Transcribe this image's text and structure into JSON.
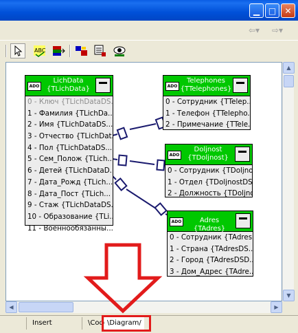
{
  "toolbar_icons": [
    "pointer-icon",
    "spell-check-icon",
    "table-color-icon",
    "link-tool-icon",
    "layout-icon",
    "view-icon"
  ],
  "diagram_tables": [
    {
      "title": "LichData",
      "subtitle": "{TLichData}",
      "icon_label": "ADO",
      "fields": [
        "0 - Ключ {TLichDataDS...",
        "1 - Фамилия {TLichDa...",
        "2 - Имя {TLichDataDS...",
        "3 - Отчество {TLichDat...",
        "4 - Пол {TLichDataDS...",
        "5 - Сем_Полож {TLich...",
        "6 - Детей {TLichDataD...",
        "7 - Дата_Рожд {TLich...",
        "8 - Дата_Пост {TLich...",
        "9 - Стаж {TLichDataDS...",
        "10 - Образование {TLi...",
        "11 - Военнообязанны..."
      ]
    },
    {
      "title": "Telephones",
      "subtitle": "{TTelephones}",
      "icon_label": "ADO",
      "fields": [
        "0 - Сотрудник {TTelep...",
        "1 - Телефон {TTelepho...",
        "2 - Примечание {TTele..."
      ]
    },
    {
      "title": "Doljnost",
      "subtitle": "{TDoljnost}",
      "icon_label": "ADO",
      "fields": [
        "0 - Сотрудник {TDoljno...",
        "1 - Отдел {TDoljnostDS...",
        "2 - Должность {TDoljno..."
      ]
    },
    {
      "title": "Adres {TAdres}",
      "subtitle": "",
      "icon_label": "ADO",
      "fields": [
        "0 - Сотрудник {TAdres...",
        "1 - Страна {TAdresDS...",
        "2 - Город {TAdresDSD...",
        "3 - Дом_Адрес {TAdre..."
      ]
    }
  ],
  "statusbar": {
    "mode": "Insert",
    "tabs": [
      "Code",
      "Diagram"
    ],
    "active_tab": "Diagram"
  },
  "colors": {
    "table_header": "#00c800",
    "link_line": "#1a1a6e",
    "annotation": "#e21b1b",
    "canvas_bg": "#ffffff"
  }
}
